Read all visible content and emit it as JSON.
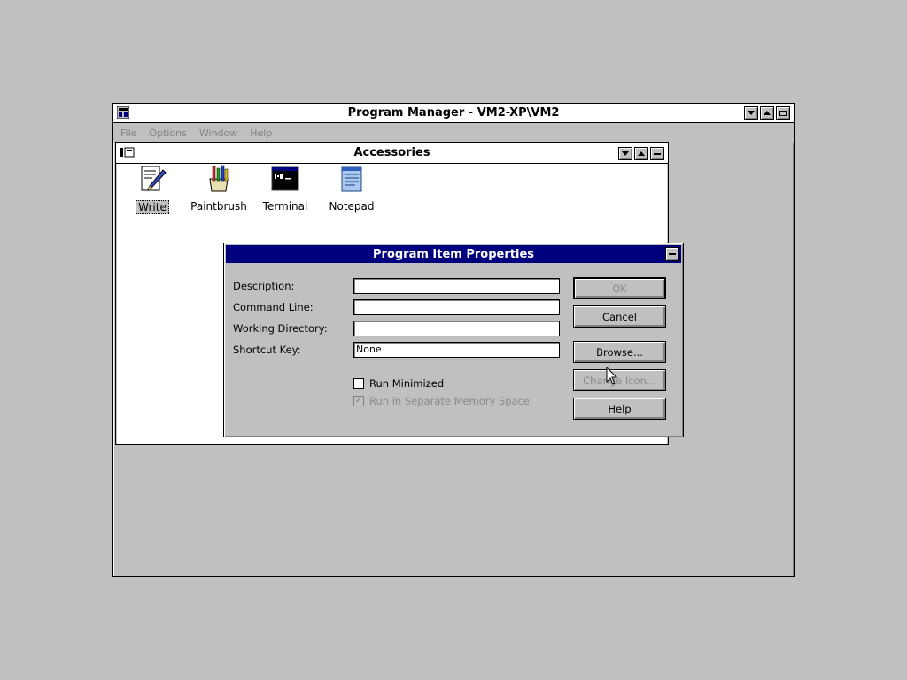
{
  "program_manager": {
    "title": "Program Manager - VM2-XP\\VM2",
    "menu": [
      "File",
      "Options",
      "Window",
      "Help"
    ]
  },
  "accessories": {
    "title": "Accessories",
    "items": [
      {
        "label": "Write",
        "icon": "write-icon"
      },
      {
        "label": "Paintbrush",
        "icon": "paintbrush-icon"
      },
      {
        "label": "Terminal",
        "icon": "terminal-icon"
      },
      {
        "label": "Notepad",
        "icon": "notepad-icon"
      }
    ]
  },
  "dialog": {
    "title": "Program Item Properties",
    "fields": {
      "description": {
        "label": "Description:",
        "value": ""
      },
      "command_line": {
        "label": "Command Line:",
        "value": ""
      },
      "working_directory": {
        "label": "Working Directory:",
        "value": ""
      },
      "shortcut_key": {
        "label": "Shortcut Key:",
        "value": "None"
      }
    },
    "checkboxes": {
      "run_minimized": {
        "label": "Run Minimized",
        "checked": false
      },
      "separate_memory": {
        "label": "Run in Separate Memory Space",
        "checked": true
      }
    },
    "buttons": {
      "ok": "OK",
      "cancel": "Cancel",
      "browse": "Browse...",
      "change_icon": "Change Icon...",
      "help": "Help"
    }
  },
  "colors": {
    "desktop": "#c0c0c0",
    "dialog_title": "#00007f"
  }
}
